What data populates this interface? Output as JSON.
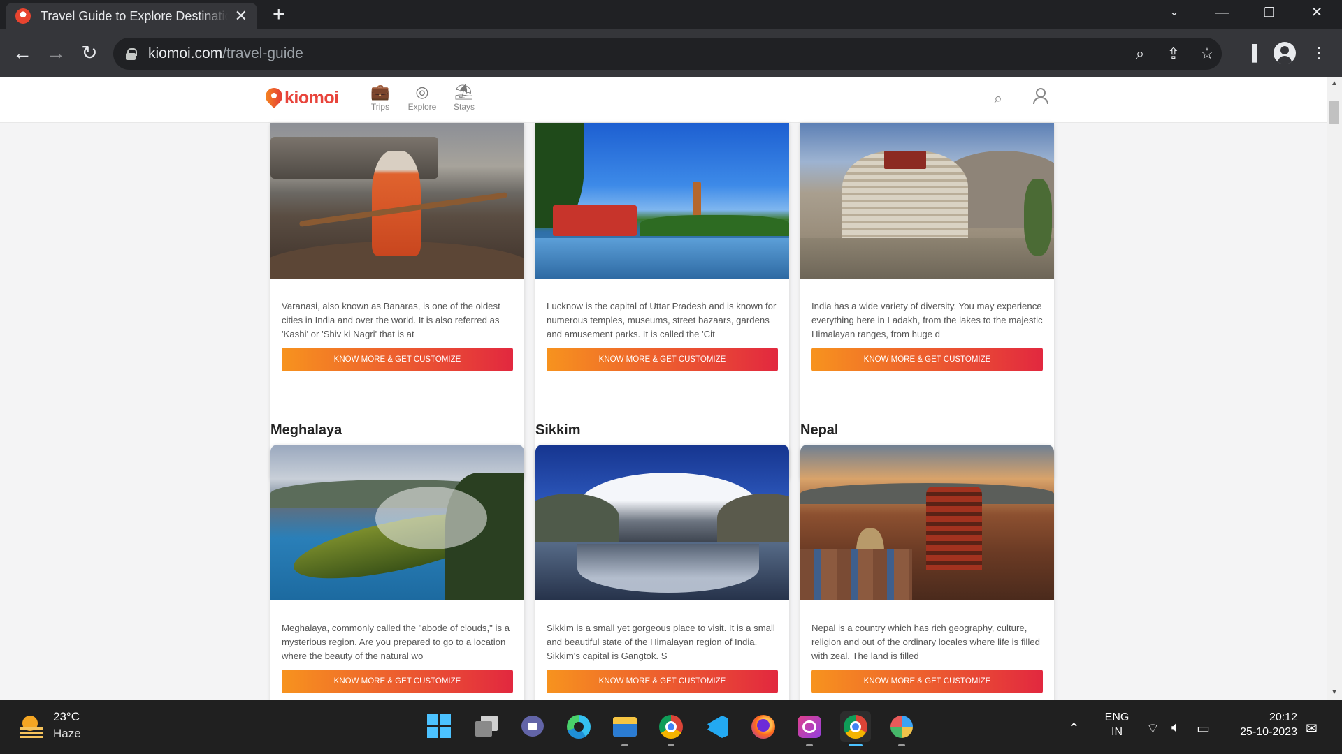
{
  "browser": {
    "tab_title": "Travel Guide to Explore Destinations",
    "url_host": "kiomoi.com",
    "url_path": "/travel-guide",
    "icons": {
      "back": "back-arrow-icon",
      "forward": "forward-arrow-icon",
      "reload": "reload-icon",
      "zoom": "zoom-icon",
      "share": "share-icon",
      "bookmark": "star-icon",
      "side_panel": "side-panel-icon",
      "profile": "profile-icon",
      "menu": "kebab-menu-icon"
    }
  },
  "site": {
    "logo_text": "kiomoi",
    "nav": [
      {
        "label": "Trips",
        "icon": "briefcase-icon"
      },
      {
        "label": "Explore",
        "icon": "globe-icon"
      },
      {
        "label": "Stays",
        "icon": "beach-icon"
      }
    ],
    "cta_label": "KNOW MORE & GET CUSTOMIZE"
  },
  "destinations_row1": [
    {
      "image": "varanasi-boatman-image",
      "description": "Varanasi, also known as Banaras, is one of the oldest cities in India and over the world. It is also referred as 'Kashi' or 'Shiv ki Nagri' that is at"
    },
    {
      "image": "lucknow-clock-tower-image",
      "description": "Lucknow is the capital of Uttar Pradesh and is known for numerous temples, museums, street bazaars, gardens and amusement parks. It is called the 'Cit"
    },
    {
      "image": "ladakh-monastery-image",
      "description": "India has a wide variety of diversity. You may experience everything here in Ladakh, from the lakes to the majestic Himalayan ranges, from huge d"
    }
  ],
  "destinations_row2": [
    {
      "title": "Meghalaya",
      "image": "meghalaya-lake-image",
      "description": "Meghalaya, commonly called the \"abode of clouds,\" is a mysterious region. Are you prepared to go to a location where the beauty of the natural wo"
    },
    {
      "title": "Sikkim",
      "image": "sikkim-mountain-lake-image",
      "description": "Sikkim is a small yet gorgeous place to visit. It is a small and beautiful state of the Himalayan region of India. Sikkim's capital is Gangtok. S"
    },
    {
      "title": "Nepal",
      "image": "nepal-temples-image",
      "description": "Nepal is a country which has rich geography, culture, religion and out of the ordinary locales where life is filled with zeal. The land is filled"
    }
  ],
  "taskbar": {
    "weather_temp": "23°C",
    "weather_desc": "Haze",
    "apps": [
      "start-icon",
      "task-view-icon",
      "teams-chat-icon",
      "edge-icon",
      "file-explorer-icon",
      "chrome-beta-icon",
      "vscode-icon",
      "firefox-icon",
      "whatsapp-icon",
      "chrome-icon",
      "control-panel-icon"
    ],
    "lang_line1": "ENG",
    "lang_line2": "IN",
    "time": "20:12",
    "date": "25-10-2023"
  },
  "colors": {
    "brand": "#e8443b",
    "cta_start": "#f7931e",
    "cta_end": "#e2283f",
    "page_bg": "#f4f4f5"
  }
}
